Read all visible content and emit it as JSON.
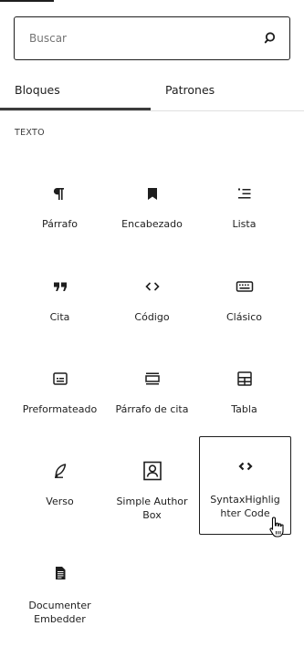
{
  "search": {
    "placeholder": "Buscar",
    "icon": "search-icon"
  },
  "tabs": [
    {
      "label": "Bloques",
      "active": true
    },
    {
      "label": "Patrones",
      "active": false
    }
  ],
  "category": {
    "label": "TEXTO"
  },
  "blocks": [
    {
      "label": "Párrafo",
      "icon": "paragraph-icon"
    },
    {
      "label": "Encabezado",
      "icon": "bookmark-icon"
    },
    {
      "label": "Lista",
      "icon": "list-icon"
    },
    {
      "label": "Cita",
      "icon": "quote-icon"
    },
    {
      "label": "Código",
      "icon": "code-icon"
    },
    {
      "label": "Clásico",
      "icon": "keyboard-icon"
    },
    {
      "label": "Preformateado",
      "icon": "preformatted-icon"
    },
    {
      "label": "Párrafo de cita",
      "icon": "pullquote-icon"
    },
    {
      "label": "Tabla",
      "icon": "table-icon"
    },
    {
      "label": "Verso",
      "icon": "feather-icon"
    },
    {
      "label": "Simple Author Box",
      "icon": "author-box-icon"
    },
    {
      "label": "SyntaxHighlighter Code",
      "icon": "code-brackets-icon",
      "hovered": true
    },
    {
      "label": "Documenter Embedder",
      "icon": "document-icon"
    }
  ],
  "colors": {
    "text": "#1e1e1e",
    "border": "#1e1e1e",
    "muted": "#757575",
    "divider": "#e0e0e0"
  }
}
